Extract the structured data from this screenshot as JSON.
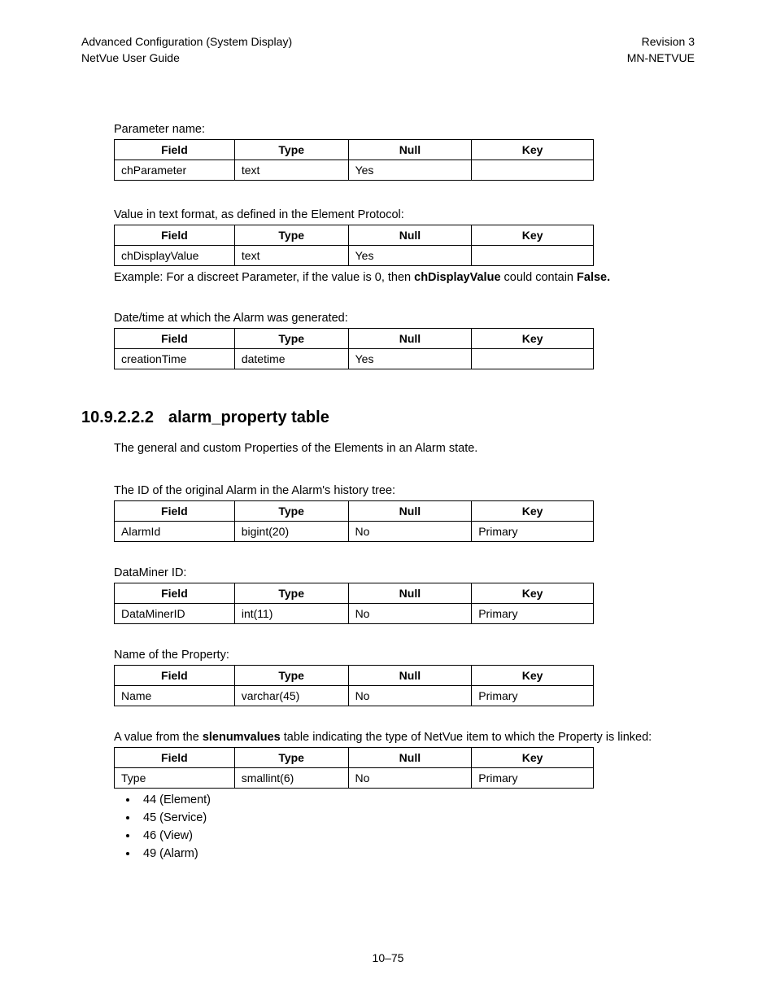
{
  "header": {
    "left1": "Advanced Configuration (System Display)",
    "left2": "NetVue User Guide",
    "right1": "Revision 3",
    "right2": "MN-NETVUE"
  },
  "table_headers": {
    "field": "Field",
    "type": "Type",
    "null": "Null",
    "key": "Key"
  },
  "blocks": {
    "b1": {
      "caption": "Parameter name:",
      "row": {
        "field": "chParameter",
        "type": "text",
        "null": "Yes",
        "key": ""
      }
    },
    "b2": {
      "caption": "Value in text format, as defined in the Element Protocol:",
      "row": {
        "field": "chDisplayValue",
        "type": "text",
        "null": "Yes",
        "key": ""
      }
    },
    "b3": {
      "caption": "Date/time at which the Alarm was generated:",
      "row": {
        "field": "creationTime",
        "type": "datetime",
        "null": "Yes",
        "key": ""
      }
    },
    "b4": {
      "caption": "The ID of the original Alarm in the Alarm's history tree:",
      "row": {
        "field": "AlarmId",
        "type": "bigint(20)",
        "null": "No",
        "key": "Primary"
      }
    },
    "b5": {
      "caption": "DataMiner ID:",
      "row": {
        "field": "DataMinerID",
        "type": "int(11)",
        "null": "No",
        "key": "Primary"
      }
    },
    "b6": {
      "caption": "Name of the Property:",
      "row": {
        "field": "Name",
        "type": "varchar(45)",
        "null": "No",
        "key": "Primary"
      }
    },
    "b7": {
      "row": {
        "field": "Type",
        "type": "smallint(6)",
        "null": "No",
        "key": "Primary"
      }
    }
  },
  "example": {
    "pre": "Example: For a discreet Parameter, if the value is 0, then ",
    "b1": "chDisplayValue",
    "mid": " could contain ",
    "b2": "False."
  },
  "section": {
    "num": "10.9.2.2.2",
    "title": "alarm_property table"
  },
  "intro": "The general and custom Properties of the Elements in an Alarm state.",
  "b7_caption": {
    "pre": "A value from the ",
    "bold": "slenumvalues",
    "post": " table indicating the type of NetVue item to which the Property is linked:"
  },
  "bullets": [
    "44 (Element)",
    "45 (Service)",
    "46 (View)",
    "49 (Alarm)"
  ],
  "footer": "10–75"
}
